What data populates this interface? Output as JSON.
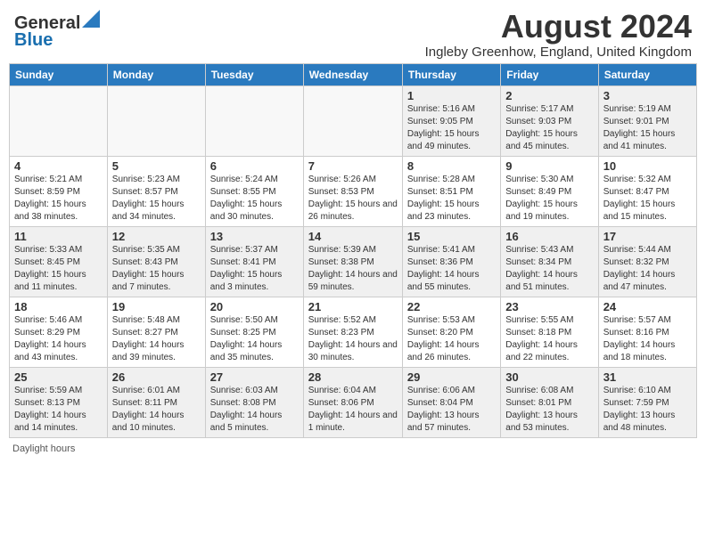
{
  "header": {
    "logo_line1": "General",
    "logo_line2": "Blue",
    "month_year": "August 2024",
    "location": "Ingleby Greenhow, England, United Kingdom"
  },
  "days_of_week": [
    "Sunday",
    "Monday",
    "Tuesday",
    "Wednesday",
    "Thursday",
    "Friday",
    "Saturday"
  ],
  "weeks": [
    [
      {
        "day": "",
        "empty": true
      },
      {
        "day": "",
        "empty": true
      },
      {
        "day": "",
        "empty": true
      },
      {
        "day": "",
        "empty": true
      },
      {
        "day": "1",
        "sunrise": "5:16 AM",
        "sunset": "9:05 PM",
        "daylight": "15 hours and 49 minutes."
      },
      {
        "day": "2",
        "sunrise": "5:17 AM",
        "sunset": "9:03 PM",
        "daylight": "15 hours and 45 minutes."
      },
      {
        "day": "3",
        "sunrise": "5:19 AM",
        "sunset": "9:01 PM",
        "daylight": "15 hours and 41 minutes."
      }
    ],
    [
      {
        "day": "4",
        "sunrise": "5:21 AM",
        "sunset": "8:59 PM",
        "daylight": "15 hours and 38 minutes."
      },
      {
        "day": "5",
        "sunrise": "5:23 AM",
        "sunset": "8:57 PM",
        "daylight": "15 hours and 34 minutes."
      },
      {
        "day": "6",
        "sunrise": "5:24 AM",
        "sunset": "8:55 PM",
        "daylight": "15 hours and 30 minutes."
      },
      {
        "day": "7",
        "sunrise": "5:26 AM",
        "sunset": "8:53 PM",
        "daylight": "15 hours and 26 minutes."
      },
      {
        "day": "8",
        "sunrise": "5:28 AM",
        "sunset": "8:51 PM",
        "daylight": "15 hours and 23 minutes."
      },
      {
        "day": "9",
        "sunrise": "5:30 AM",
        "sunset": "8:49 PM",
        "daylight": "15 hours and 19 minutes."
      },
      {
        "day": "10",
        "sunrise": "5:32 AM",
        "sunset": "8:47 PM",
        "daylight": "15 hours and 15 minutes."
      }
    ],
    [
      {
        "day": "11",
        "sunrise": "5:33 AM",
        "sunset": "8:45 PM",
        "daylight": "15 hours and 11 minutes."
      },
      {
        "day": "12",
        "sunrise": "5:35 AM",
        "sunset": "8:43 PM",
        "daylight": "15 hours and 7 minutes."
      },
      {
        "day": "13",
        "sunrise": "5:37 AM",
        "sunset": "8:41 PM",
        "daylight": "15 hours and 3 minutes."
      },
      {
        "day": "14",
        "sunrise": "5:39 AM",
        "sunset": "8:38 PM",
        "daylight": "14 hours and 59 minutes."
      },
      {
        "day": "15",
        "sunrise": "5:41 AM",
        "sunset": "8:36 PM",
        "daylight": "14 hours and 55 minutes."
      },
      {
        "day": "16",
        "sunrise": "5:43 AM",
        "sunset": "8:34 PM",
        "daylight": "14 hours and 51 minutes."
      },
      {
        "day": "17",
        "sunrise": "5:44 AM",
        "sunset": "8:32 PM",
        "daylight": "14 hours and 47 minutes."
      }
    ],
    [
      {
        "day": "18",
        "sunrise": "5:46 AM",
        "sunset": "8:29 PM",
        "daylight": "14 hours and 43 minutes."
      },
      {
        "day": "19",
        "sunrise": "5:48 AM",
        "sunset": "8:27 PM",
        "daylight": "14 hours and 39 minutes."
      },
      {
        "day": "20",
        "sunrise": "5:50 AM",
        "sunset": "8:25 PM",
        "daylight": "14 hours and 35 minutes."
      },
      {
        "day": "21",
        "sunrise": "5:52 AM",
        "sunset": "8:23 PM",
        "daylight": "14 hours and 30 minutes."
      },
      {
        "day": "22",
        "sunrise": "5:53 AM",
        "sunset": "8:20 PM",
        "daylight": "14 hours and 26 minutes."
      },
      {
        "day": "23",
        "sunrise": "5:55 AM",
        "sunset": "8:18 PM",
        "daylight": "14 hours and 22 minutes."
      },
      {
        "day": "24",
        "sunrise": "5:57 AM",
        "sunset": "8:16 PM",
        "daylight": "14 hours and 18 minutes."
      }
    ],
    [
      {
        "day": "25",
        "sunrise": "5:59 AM",
        "sunset": "8:13 PM",
        "daylight": "14 hours and 14 minutes."
      },
      {
        "day": "26",
        "sunrise": "6:01 AM",
        "sunset": "8:11 PM",
        "daylight": "14 hours and 10 minutes."
      },
      {
        "day": "27",
        "sunrise": "6:03 AM",
        "sunset": "8:08 PM",
        "daylight": "14 hours and 5 minutes."
      },
      {
        "day": "28",
        "sunrise": "6:04 AM",
        "sunset": "8:06 PM",
        "daylight": "14 hours and 1 minute."
      },
      {
        "day": "29",
        "sunrise": "6:06 AM",
        "sunset": "8:04 PM",
        "daylight": "13 hours and 57 minutes."
      },
      {
        "day": "30",
        "sunrise": "6:08 AM",
        "sunset": "8:01 PM",
        "daylight": "13 hours and 53 minutes."
      },
      {
        "day": "31",
        "sunrise": "6:10 AM",
        "sunset": "7:59 PM",
        "daylight": "13 hours and 48 minutes."
      }
    ]
  ],
  "footer": {
    "daylight_label": "Daylight hours"
  }
}
